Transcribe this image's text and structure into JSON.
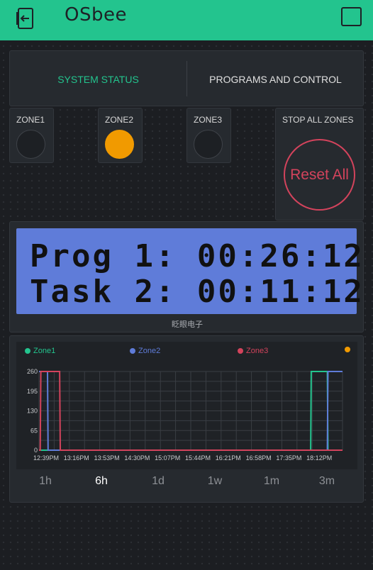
{
  "app": {
    "title": "OSbee"
  },
  "colors": {
    "accent": "#23c48e",
    "zone1": "#23c48e",
    "zone2": "#5f7cd9",
    "zone3": "#d3435c",
    "extra": "#f19a00",
    "led_on": "#f19a00",
    "lcd_bg": "#5f7cd9"
  },
  "tabs": [
    {
      "label": "SYSTEM STATUS",
      "active": true
    },
    {
      "label": "PROGRAMS AND CONTROL",
      "active": false
    }
  ],
  "zones": [
    {
      "label": "ZONE1",
      "on": false
    },
    {
      "label": "ZONE2",
      "on": true
    },
    {
      "label": "ZONE3",
      "on": false
    }
  ],
  "stop": {
    "label": "STOP ALL ZONES",
    "button": "Reset All"
  },
  "lcd": {
    "line1": "Prog 1: 00:26:12",
    "line2": "Task 2: 00:11:12",
    "caption": "眨眼电子"
  },
  "chart_data": {
    "type": "line",
    "legend": [
      "Zone1",
      "Zone2",
      "Zone3",
      ""
    ],
    "yticks": [
      0,
      65,
      130,
      195,
      260
    ],
    "ylim": [
      0,
      260
    ],
    "xticks": [
      "12:39PM",
      "13:16PM",
      "13:53PM",
      "14:30PM",
      "15:07PM",
      "15:44PM",
      "16:21PM",
      "16:58PM",
      "17:35PM",
      "18:12PM"
    ],
    "xlim": [
      0,
      10.0
    ],
    "series": [
      {
        "name": "Zone1",
        "color": "#23c48e",
        "points": [
          [
            0,
            0
          ],
          [
            8.95,
            0
          ],
          [
            8.97,
            260
          ],
          [
            9.5,
            260
          ],
          [
            9.52,
            0
          ],
          [
            10.0,
            0
          ]
        ]
      },
      {
        "name": "Zone2",
        "color": "#5f7cd9",
        "points": [
          [
            0,
            260
          ],
          [
            0.28,
            260
          ],
          [
            0.3,
            0
          ],
          [
            9.5,
            0
          ],
          [
            9.52,
            260
          ],
          [
            10.0,
            260
          ]
        ]
      },
      {
        "name": "Zone3",
        "color": "#d3435c",
        "points": [
          [
            0,
            0
          ],
          [
            0.04,
            0
          ],
          [
            0.06,
            260
          ],
          [
            0.68,
            260
          ],
          [
            0.7,
            0
          ],
          [
            10.0,
            0
          ]
        ]
      }
    ]
  },
  "ranges": [
    {
      "label": "1h",
      "active": false
    },
    {
      "label": "6h",
      "active": true
    },
    {
      "label": "1d",
      "active": false
    },
    {
      "label": "1w",
      "active": false
    },
    {
      "label": "1m",
      "active": false
    },
    {
      "label": "3m",
      "active": false
    }
  ]
}
